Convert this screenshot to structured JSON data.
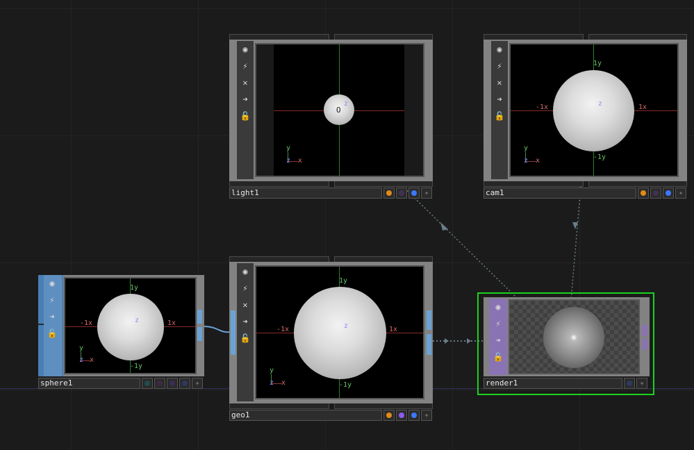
{
  "nodes": {
    "light1": {
      "name": "light1",
      "axes": {
        "z": "z",
        "origin": "O"
      },
      "gizmo": {
        "y": "y",
        "x": "x",
        "z": "z"
      },
      "flags": [
        "#e08a17",
        "#403250",
        "#3c78ff"
      ]
    },
    "cam1": {
      "name": "cam1",
      "axes": {
        "y_pos": "1y",
        "y_neg": "-1y",
        "x_pos": "1x",
        "x_neg": "-1x",
        "z": "z"
      },
      "gizmo": {
        "y": "y",
        "x": "x",
        "z": "z"
      },
      "flags": [
        "#e08a17",
        "#403250",
        "#3c78ff"
      ]
    },
    "sphere1": {
      "name": "sphere1",
      "axes": {
        "y_pos": "1y",
        "y_neg": "-1y",
        "x_pos": "1x",
        "x_neg": "-1x",
        "z": "z"
      },
      "gizmo": {
        "y": "y",
        "x": "x",
        "z": "z"
      },
      "flags": [
        "#224b50",
        "#3e2842",
        "#3a2e55",
        "#2d3a5f"
      ]
    },
    "geo1": {
      "name": "geo1",
      "axes": {
        "y_pos": "1y",
        "y_neg": "-1y",
        "x_pos": "1x",
        "x_neg": "-1x",
        "z": "z"
      },
      "gizmo": {
        "y": "y",
        "x": "x",
        "z": "z"
      },
      "flags": [
        "#e08a17",
        "#8a5cf0",
        "#3c78ff"
      ]
    },
    "render1": {
      "name": "render1",
      "flags": [
        "#2d3a5f"
      ]
    }
  },
  "colors": {
    "selection": "#19d31d",
    "wire": "#6aa2d6",
    "dependency": "#6a7d8a"
  }
}
